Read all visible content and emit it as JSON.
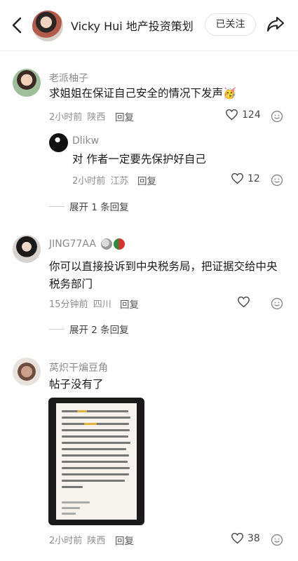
{
  "header": {
    "title": "Vicky Hui 地产投资策划",
    "follow_label": "已关注"
  },
  "comments": [
    {
      "user": "老派柚子",
      "text": "求姐姐在保证自己安全的情况下发声",
      "emoji": "🥳",
      "time": "2小时前",
      "location": "陕西",
      "reply_label": "回复",
      "likes": "124",
      "replies": [
        {
          "user": "Dlikw",
          "text": "对 作者一定要先保护好自己",
          "time": "2小时前",
          "location": "江苏",
          "reply_label": "回复",
          "likes": "12"
        }
      ],
      "expand_label": "展开 1 条回复"
    },
    {
      "user": "JING77AA",
      "text": "你可以直接投诉到中央税务局，把证据交给中央税务部门",
      "time": "15分钟前",
      "location": "四川",
      "reply_label": "回复",
      "likes": "",
      "expand_label": "展开 2 条回复"
    },
    {
      "user": "莴炽干煸豆角",
      "text": "帖子没有了",
      "time": "2小时前",
      "location": "陕西",
      "reply_label": "回复",
      "likes": "38"
    }
  ],
  "icons": {
    "back": "chevron-left-icon",
    "share": "share-arrow-icon",
    "like": "heart-outline-icon",
    "emoji": "smiley-icon"
  },
  "colors": {
    "accent": "#e2b33a"
  }
}
